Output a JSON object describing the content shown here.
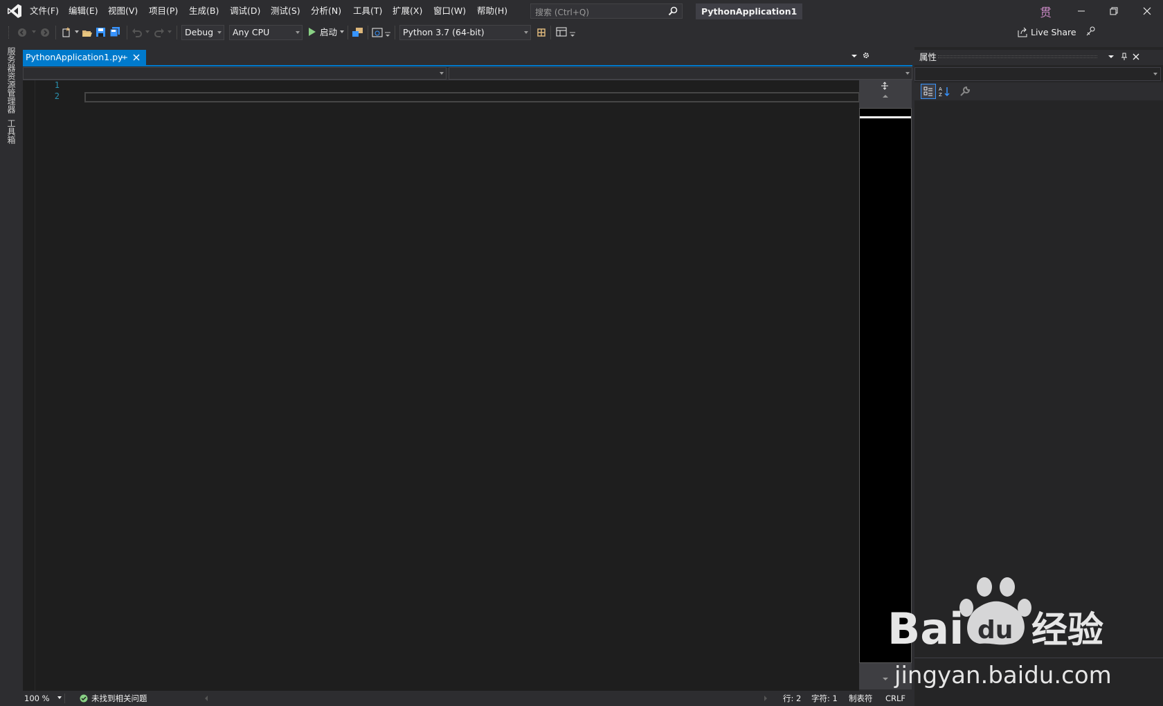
{
  "menu": {
    "items": [
      "文件(F)",
      "编辑(E)",
      "视图(V)",
      "项目(P)",
      "生成(B)",
      "调试(D)",
      "测试(S)",
      "分析(N)",
      "工具(T)",
      "扩展(X)",
      "窗口(W)",
      "帮助(H)"
    ]
  },
  "search": {
    "placeholder": "搜索 (Ctrl+Q)"
  },
  "solution_title": "PythonApplication1",
  "user_initial": "贯",
  "toolbar": {
    "configuration": "Debug",
    "platform": "Any CPU",
    "start_label": "启动",
    "environment": "Python 3.7 (64-bit)",
    "live_share": "Live Share"
  },
  "left_tabs": [
    "服务器资源管理器",
    "工具箱"
  ],
  "document_tab": {
    "filename": "PythonApplication1.py"
  },
  "editor": {
    "line_numbers": [
      "1",
      "2"
    ]
  },
  "status": {
    "zoom": "100 %",
    "issues": "未找到相关问题",
    "line": "行: 2",
    "char": "字符: 1",
    "indent": "制表符",
    "eol": "CRLF"
  },
  "properties": {
    "title": "属性"
  },
  "watermark": {
    "brand": "Bai",
    "brand2": "du",
    "product": "经验",
    "url": "jingyan.baidu.com"
  },
  "colors": {
    "accent": "#007acc",
    "background": "#2d2d30",
    "editor": "#1e1e1e",
    "line_number": "#2b91af",
    "vs_purple": "#ffffff"
  }
}
